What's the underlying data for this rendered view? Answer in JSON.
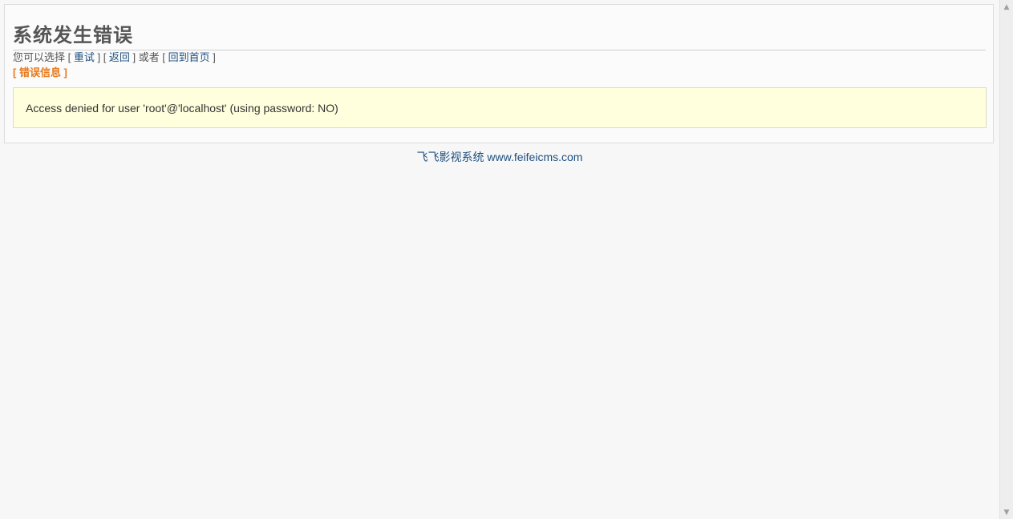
{
  "error": {
    "title": "系统发生错误",
    "options_prefix": "您可以选择 [ ",
    "retry_label": "重试",
    "sep1": " ] [ ",
    "back_label": "返回",
    "sep2": " ] 或者 [ ",
    "home_label": "回到首页",
    "options_suffix": " ]",
    "info_label": "[ 错误信息 ]",
    "message": "Access denied for user 'root'@'localhost' (using password: NO)"
  },
  "footer": {
    "site_name": "飞飞影视系统",
    "site_url": "www.feifeicms.com"
  },
  "icons": {
    "scroll_up": "scroll-up-arrow",
    "scroll_down": "scroll-down-arrow"
  },
  "colors": {
    "link": "#1d4f80",
    "info_label": "#e87a1e",
    "message_bg": "#ffffdd"
  }
}
